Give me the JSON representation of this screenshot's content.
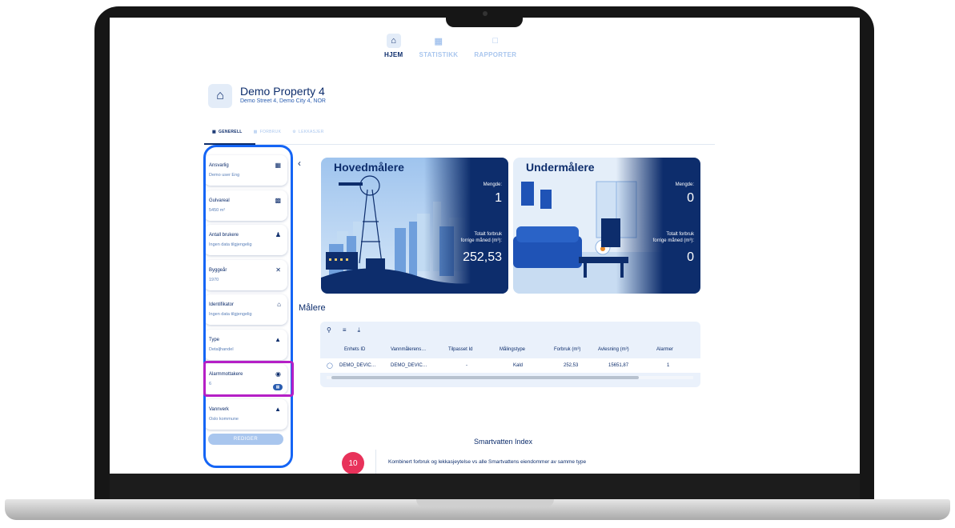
{
  "nav": {
    "tabs": [
      {
        "label": "HJEM",
        "icon": "home-icon",
        "active": true
      },
      {
        "label": "STATISTIKK",
        "icon": "chart-icon",
        "active": false
      },
      {
        "label": "RAPPORTER",
        "icon": "clipboard-icon",
        "active": false
      }
    ]
  },
  "property": {
    "title": "Demo Property 4",
    "address": "Demo Street 4, Demo City 4, NOR"
  },
  "subtabs": [
    {
      "label": "GENERELL",
      "icon": "building-icon",
      "active": true
    },
    {
      "label": "FORBRUK",
      "icon": "bar-chart-icon",
      "active": false
    },
    {
      "label": "LEKKASJER",
      "icon": "gear-icon",
      "active": false
    }
  ],
  "sidebar": {
    "items": [
      {
        "label": "Ansvarlig",
        "value": "Demo user Eng",
        "icon": "contact-card-icon"
      },
      {
        "label": "Gulvareal",
        "value": "5450 m²",
        "icon": "building-icon"
      },
      {
        "label": "Antall brukere",
        "value": "Ingen data tilgjengelig",
        "icon": "users-icon"
      },
      {
        "label": "Byggeår",
        "value": "1970",
        "icon": "tools-icon"
      },
      {
        "label": "Identifikator",
        "value": "Ingen data tilgjengelig",
        "icon": "home-icon"
      },
      {
        "label": "Type",
        "value": "Detaljhandel",
        "icon": "house-icon"
      },
      {
        "label": "Alarmmottakere",
        "value": "6",
        "icon": "bell-icon"
      },
      {
        "label": "Vannverk",
        "value": "Oslo kommune",
        "icon": "water-house-icon"
      }
    ],
    "edit_label": "REDIGER"
  },
  "meters": {
    "main": {
      "title": "Hovedmålere",
      "mengde_label": "Mengde:",
      "mengde": "1",
      "total_label_line1": "Totalt forbruk",
      "total_label_line2": "forrige måned (m³):",
      "total": "252,53"
    },
    "sub": {
      "title": "Undermålere",
      "mengde_label": "Mengde:",
      "mengde": "0",
      "total_label_line1": "Totalt forbruk",
      "total_label_line2": "forrige måned (m³):",
      "total": "0"
    }
  },
  "table": {
    "title": "Målere",
    "columns": [
      "Enhets ID",
      "Vannmålerens…",
      "Tilpasset Id",
      "Målingstype",
      "Forbruk (m³)",
      "Avlesning (m³)",
      "Alarmer"
    ],
    "rows": [
      [
        "DEMO_DEVIC…",
        "DEMO_DEVIC…",
        "-",
        "Kald",
        "252,53",
        "15651,87",
        "1"
      ]
    ]
  },
  "index": {
    "title": "Smartvatten Index",
    "score": "10",
    "description": "Kombinert forbruk og lekkasjeytelse vs alle Smartvattens eiendommer av samme type"
  },
  "colors": {
    "navy": "#0d2d6c",
    "light_blue": "#a9c6ee",
    "highlight_blue": "#1565f5",
    "highlight_purple": "#b51fc6",
    "score_red": "#e8325a"
  }
}
